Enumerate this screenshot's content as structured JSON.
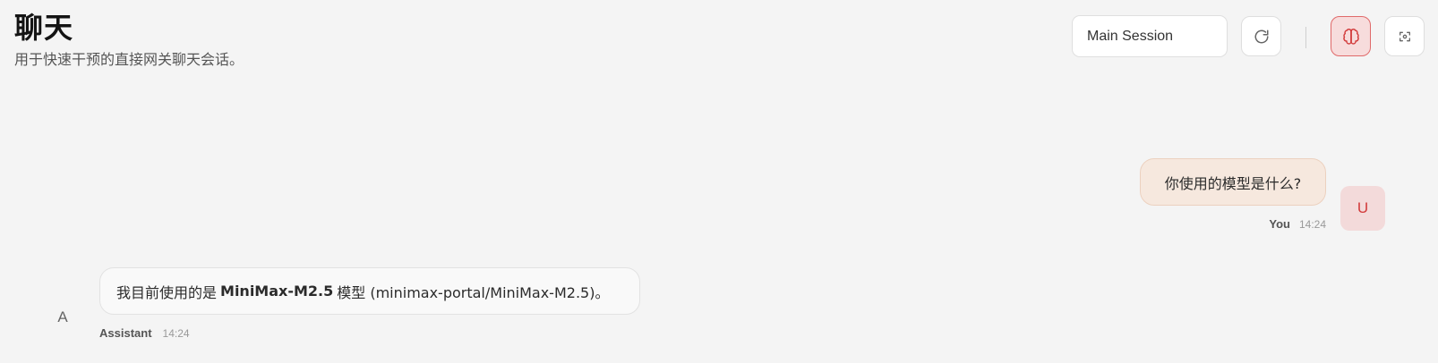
{
  "header": {
    "title": "聊天",
    "subtitle": "用于快速干预的直接网关聊天会话。"
  },
  "toolbar": {
    "session_value": "Main Session",
    "refresh_icon": "refresh-icon",
    "brain_icon": "brain-icon",
    "focus_icon": "focus-icon",
    "accent_color": "#e06a6a"
  },
  "messages": {
    "user": {
      "text": "你使用的模型是什么?",
      "avatar": "U",
      "name": "You",
      "time": "14:24"
    },
    "assistant": {
      "text_before": "我目前使用的是",
      "text_bold": "MiniMax-M2.5",
      "text_after": "模型 (minimax-portal/MiniMax-M2.5)。",
      "avatar": "A",
      "name": "Assistant",
      "time": "14:24"
    }
  }
}
